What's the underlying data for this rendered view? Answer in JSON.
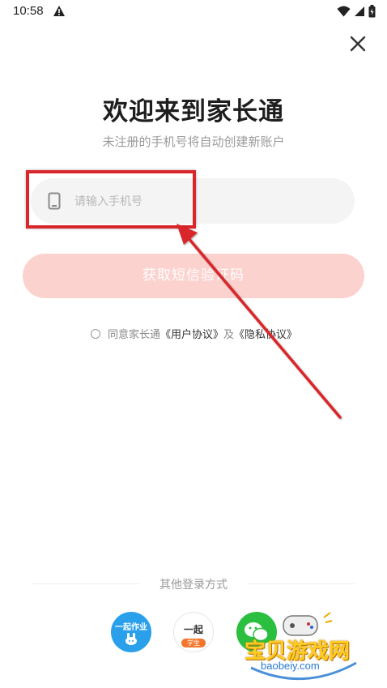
{
  "status_bar": {
    "time": "10:58"
  },
  "page": {
    "title": "欢迎来到家长通",
    "subtitle": "未注册的手机号将自动创建新账户"
  },
  "phone": {
    "placeholder": "请输入手机号",
    "value": ""
  },
  "sms_button": {
    "label": "获取短信验证码"
  },
  "agreement": {
    "prefix": "同意家长通",
    "user_agreement": "《用户协议》",
    "and": "及",
    "privacy": "《隐私协议》"
  },
  "other_login": {
    "label": "其他登录方式",
    "homework_icon_text": "一起作业",
    "student_icon_text": "一起",
    "student_icon_sub": "学生"
  },
  "watermark": {
    "text": "宝贝游戏网",
    "url": "baobeiy.com"
  },
  "colors": {
    "accent": "#fcd2cf",
    "annotation": "#d9262a"
  }
}
